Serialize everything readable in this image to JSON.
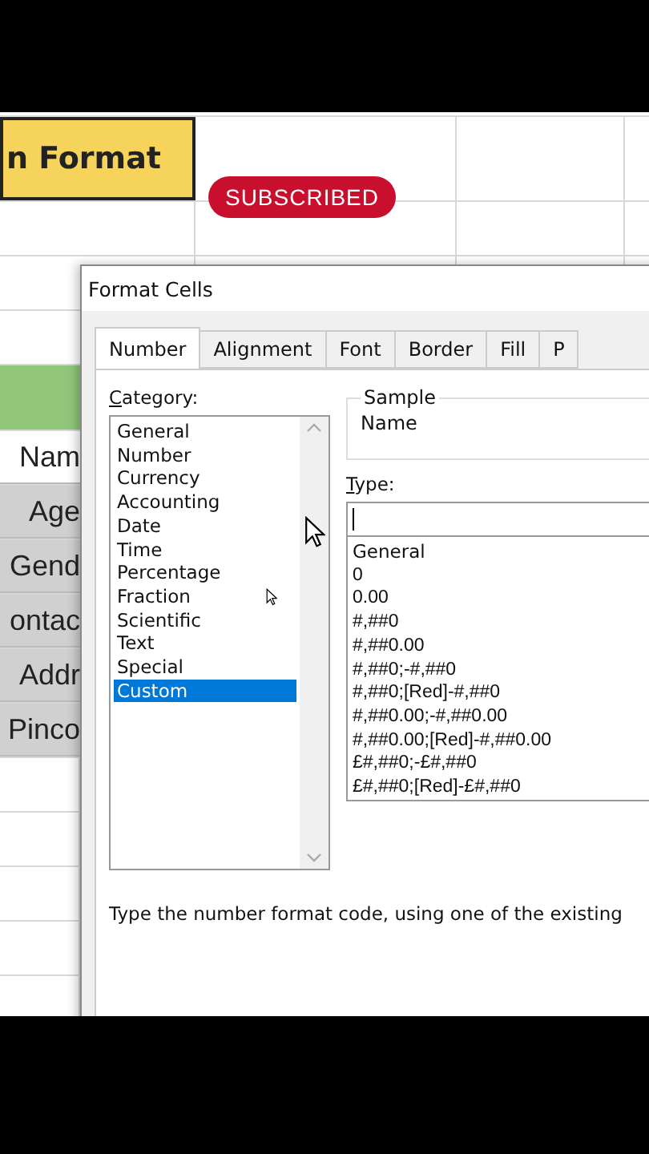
{
  "spreadsheet": {
    "title_cell": "n Format",
    "subscribe_button": "SUBSCRIBED",
    "row_labels": [
      {
        "label": "Nam",
        "shaded": false
      },
      {
        "label": "Age",
        "shaded": true
      },
      {
        "label": "Gend",
        "shaded": true
      },
      {
        "label": "ontac",
        "shaded": true
      },
      {
        "label": "Addr",
        "shaded": true
      },
      {
        "label": "Pinco",
        "shaded": true
      }
    ]
  },
  "dialog": {
    "title": "Format Cells",
    "tabs": [
      {
        "label": "Number",
        "selected": true
      },
      {
        "label": "Alignment",
        "selected": false
      },
      {
        "label": "Font",
        "selected": false
      },
      {
        "label": "Border",
        "selected": false
      },
      {
        "label": "Fill",
        "selected": false
      },
      {
        "label": "P",
        "selected": false
      }
    ],
    "category_label": "Category:",
    "categories": [
      {
        "label": "General",
        "selected": false
      },
      {
        "label": "Number",
        "selected": false
      },
      {
        "label": "Currency",
        "selected": false
      },
      {
        "label": "Accounting",
        "selected": false
      },
      {
        "label": "Date",
        "selected": false
      },
      {
        "label": "Time",
        "selected": false
      },
      {
        "label": "Percentage",
        "selected": false
      },
      {
        "label": "Fraction",
        "selected": false
      },
      {
        "label": "Scientific",
        "selected": false
      },
      {
        "label": "Text",
        "selected": false
      },
      {
        "label": "Special",
        "selected": false
      },
      {
        "label": "Custom",
        "selected": true
      }
    ],
    "sample_label": "Sample",
    "sample_value": "Name",
    "type_label": "Type:",
    "formats": [
      "General",
      "0",
      "0.00",
      "#,##0",
      "#,##0.00",
      "#,##0;-#,##0",
      "#,##0;[Red]-#,##0",
      "#,##0.00;-#,##0.00",
      "#,##0.00;[Red]-#,##0.00",
      "£#,##0;-£#,##0",
      "£#,##0;[Red]-£#,##0"
    ],
    "description": "Type the number format code, using one of the existing"
  }
}
